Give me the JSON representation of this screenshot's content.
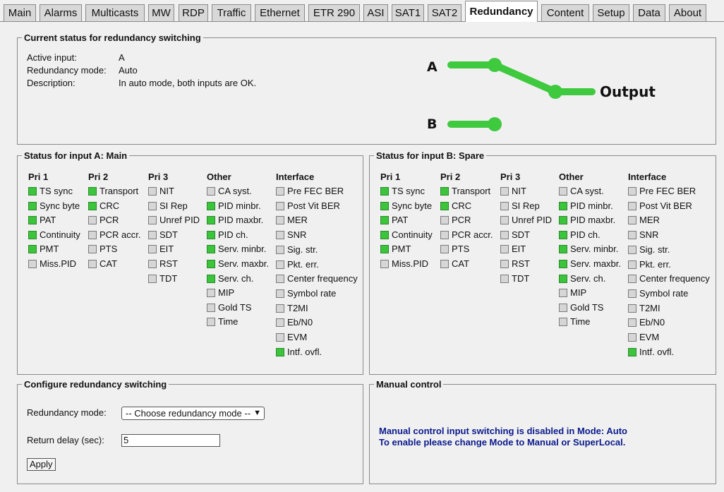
{
  "tabs": [
    {
      "label": "Main",
      "active": false
    },
    {
      "label": "Alarms",
      "active": false
    },
    {
      "label": "Multicasts",
      "active": false
    },
    {
      "label": "MW",
      "active": false
    },
    {
      "label": "RDP",
      "active": false
    },
    {
      "label": "Traffic",
      "active": false
    },
    {
      "label": "Ethernet",
      "active": false
    },
    {
      "label": "ETR 290",
      "active": false
    },
    {
      "label": "ASI",
      "active": false
    },
    {
      "label": "SAT1",
      "active": false
    },
    {
      "label": "SAT2",
      "active": false
    },
    {
      "label": "Redundancy",
      "active": true
    },
    {
      "label": "Content",
      "active": false
    },
    {
      "label": "Setup",
      "active": false
    },
    {
      "label": "Data",
      "active": false
    },
    {
      "label": "About",
      "active": false
    }
  ],
  "current_status": {
    "title": "Current status for redundancy switching",
    "active_input_label": "Active input:",
    "active_input_value": "A",
    "mode_label": "Redundancy mode:",
    "mode_value": "Auto",
    "description_label": "Description:",
    "description_value": "In auto mode, both inputs are OK.",
    "diagram": {
      "input_a": "A",
      "input_b": "B",
      "output": "Output",
      "switch_position": "A",
      "line_color": "#3ec93e"
    }
  },
  "column_headers": [
    "Pri 1",
    "Pri 2",
    "Pri 3",
    "Other",
    "Interface"
  ],
  "input_a": {
    "title": "Status for input A: Main",
    "columns": [
      [
        {
          "label": "TS sync",
          "ok": true
        },
        {
          "label": "Sync byte",
          "ok": true
        },
        {
          "label": "PAT",
          "ok": true
        },
        {
          "label": "Continuity",
          "ok": true
        },
        {
          "label": "PMT",
          "ok": true
        },
        {
          "label": "Miss.PID",
          "ok": false
        }
      ],
      [
        {
          "label": "Transport",
          "ok": true
        },
        {
          "label": "CRC",
          "ok": true
        },
        {
          "label": "PCR",
          "ok": false
        },
        {
          "label": "PCR accr.",
          "ok": false
        },
        {
          "label": "PTS",
          "ok": false
        },
        {
          "label": "CAT",
          "ok": false
        }
      ],
      [
        {
          "label": "NIT",
          "ok": false
        },
        {
          "label": "SI Rep",
          "ok": false
        },
        {
          "label": "Unref PID",
          "ok": false
        },
        {
          "label": "SDT",
          "ok": false
        },
        {
          "label": "EIT",
          "ok": false
        },
        {
          "label": "RST",
          "ok": false
        },
        {
          "label": "TDT",
          "ok": false
        }
      ],
      [
        {
          "label": "CA syst.",
          "ok": false
        },
        {
          "label": "PID minbr.",
          "ok": true
        },
        {
          "label": "PID maxbr.",
          "ok": true
        },
        {
          "label": "PID ch.",
          "ok": true
        },
        {
          "label": "Serv. minbr.",
          "ok": true
        },
        {
          "label": "Serv. maxbr.",
          "ok": true
        },
        {
          "label": "Serv. ch.",
          "ok": true
        },
        {
          "label": "MIP",
          "ok": false
        },
        {
          "label": "Gold TS",
          "ok": false
        },
        {
          "label": "Time",
          "ok": false
        }
      ],
      [
        {
          "label": "Pre FEC BER",
          "ok": false
        },
        {
          "label": "Post Vit BER",
          "ok": false
        },
        {
          "label": "MER",
          "ok": false
        },
        {
          "label": "SNR",
          "ok": false
        },
        {
          "label": "Sig. str.",
          "ok": false
        },
        {
          "label": "Pkt. err.",
          "ok": false
        },
        {
          "label": "Center frequency",
          "ok": false
        },
        {
          "label": "Symbol rate",
          "ok": false
        },
        {
          "label": "T2MI",
          "ok": false
        },
        {
          "label": "Eb/N0",
          "ok": false
        },
        {
          "label": "EVM",
          "ok": false
        },
        {
          "label": "Intf. ovfl.",
          "ok": true
        }
      ]
    ]
  },
  "input_b": {
    "title": "Status for input B: Spare",
    "columns": [
      [
        {
          "label": "TS sync",
          "ok": true
        },
        {
          "label": "Sync byte",
          "ok": true
        },
        {
          "label": "PAT",
          "ok": true
        },
        {
          "label": "Continuity",
          "ok": true
        },
        {
          "label": "PMT",
          "ok": true
        },
        {
          "label": "Miss.PID",
          "ok": false
        }
      ],
      [
        {
          "label": "Transport",
          "ok": true
        },
        {
          "label": "CRC",
          "ok": true
        },
        {
          "label": "PCR",
          "ok": false
        },
        {
          "label": "PCR accr.",
          "ok": false
        },
        {
          "label": "PTS",
          "ok": false
        },
        {
          "label": "CAT",
          "ok": false
        }
      ],
      [
        {
          "label": "NIT",
          "ok": false
        },
        {
          "label": "SI Rep",
          "ok": false
        },
        {
          "label": "Unref PID",
          "ok": false
        },
        {
          "label": "SDT",
          "ok": false
        },
        {
          "label": "EIT",
          "ok": false
        },
        {
          "label": "RST",
          "ok": false
        },
        {
          "label": "TDT",
          "ok": false
        }
      ],
      [
        {
          "label": "CA syst.",
          "ok": false
        },
        {
          "label": "PID minbr.",
          "ok": true
        },
        {
          "label": "PID maxbr.",
          "ok": true
        },
        {
          "label": "PID ch.",
          "ok": true
        },
        {
          "label": "Serv. minbr.",
          "ok": true
        },
        {
          "label": "Serv. maxbr.",
          "ok": true
        },
        {
          "label": "Serv. ch.",
          "ok": true
        },
        {
          "label": "MIP",
          "ok": false
        },
        {
          "label": "Gold TS",
          "ok": false
        },
        {
          "label": "Time",
          "ok": false
        }
      ],
      [
        {
          "label": "Pre FEC BER",
          "ok": false
        },
        {
          "label": "Post Vit BER",
          "ok": false
        },
        {
          "label": "MER",
          "ok": false
        },
        {
          "label": "SNR",
          "ok": false
        },
        {
          "label": "Sig. str.",
          "ok": false
        },
        {
          "label": "Pkt. err.",
          "ok": false
        },
        {
          "label": "Center frequency",
          "ok": false
        },
        {
          "label": "Symbol rate",
          "ok": false
        },
        {
          "label": "T2MI",
          "ok": false
        },
        {
          "label": "Eb/N0",
          "ok": false
        },
        {
          "label": "EVM",
          "ok": false
        },
        {
          "label": "Intf. ovfl.",
          "ok": true
        }
      ]
    ]
  },
  "configure": {
    "title": "Configure redundancy switching",
    "mode_label": "Redundancy mode:",
    "mode_select_value": "-- Choose redundancy mode --",
    "delay_label": "Return delay (sec):",
    "delay_value": "5",
    "apply_label": "Apply"
  },
  "manual": {
    "title": "Manual control",
    "line1": "Manual control input switching is disabled in Mode: Auto",
    "line2": "To enable please change Mode to Manual or SuperLocal."
  },
  "colors": {
    "ok": "#3cc43c",
    "inactive": "#d6d6d6",
    "message": "#0a1a8c"
  }
}
